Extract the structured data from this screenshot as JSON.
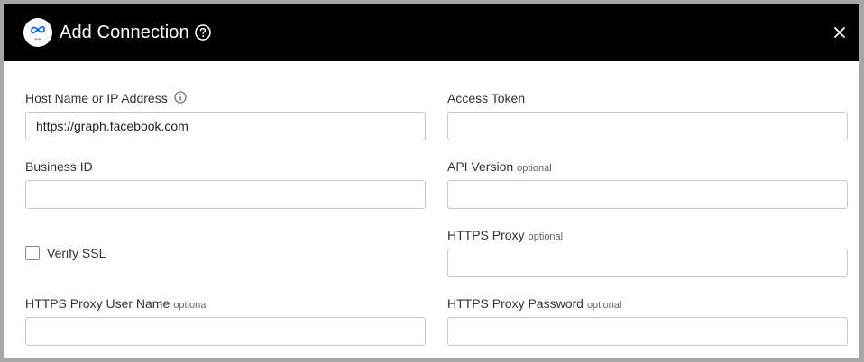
{
  "dialog": {
    "title": "Add Connection",
    "logo_caption": "Meta",
    "icons": {
      "logo": "meta-logo-icon",
      "help": "help-circle-icon",
      "close": "close-icon",
      "info": "info-circle-icon"
    }
  },
  "form": {
    "host": {
      "label": "Host Name or IP Address",
      "value": "https://graph.facebook.com"
    },
    "access_token": {
      "label": "Access Token",
      "value": ""
    },
    "business_id": {
      "label": "Business ID",
      "value": ""
    },
    "api_version": {
      "label": "API Version",
      "optional": "optional",
      "value": ""
    },
    "verify_ssl": {
      "label": "Verify SSL",
      "checked": false
    },
    "https_proxy": {
      "label": "HTTPS Proxy",
      "optional": "optional",
      "value": ""
    },
    "proxy_user": {
      "label": "HTTPS Proxy User Name",
      "optional": "optional",
      "value": ""
    },
    "proxy_password": {
      "label": "HTTPS Proxy Password",
      "optional": "optional",
      "value": ""
    }
  },
  "colors": {
    "header_bg": "#000000",
    "header_text": "#ffffff",
    "border": "#a7a7a7",
    "input_border": "#c8c8c8",
    "meta_blue": "#0866ff"
  }
}
